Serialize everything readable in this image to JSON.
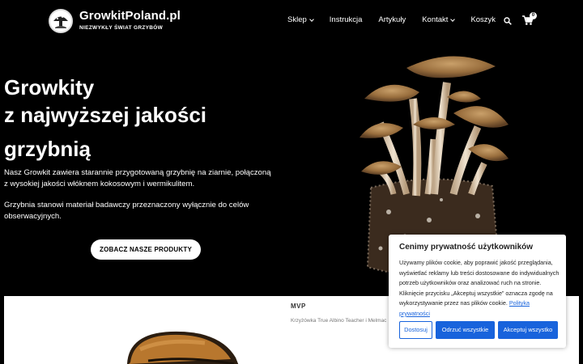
{
  "brand": {
    "name": "GrowkitPoland.pl",
    "tagline": "NIEZWYKŁY ŚWIAT GRZYBÓW"
  },
  "nav": {
    "items": [
      {
        "label": "Sklep",
        "dropdown": true
      },
      {
        "label": "Instrukcja",
        "dropdown": false
      },
      {
        "label": "Artykuły",
        "dropdown": false
      },
      {
        "label": "Kontakt",
        "dropdown": true
      },
      {
        "label": "Koszyk",
        "dropdown": false
      }
    ],
    "search_icon": "search-icon",
    "cart_icon": "cart-icon",
    "cart_count": "0"
  },
  "hero": {
    "title_line1": "Growkity",
    "title_line2": "z najwyższej jakości",
    "title_line3": "grzybnią",
    "paragraph1": "Nasz Growkit zawiera starannie przygotowaną grzybnię na ziarnie, połączoną z wysokiej jakości włóknem kokosowym i wermikulitem.",
    "paragraph2": "Grzybnia stanowi materiał badawczy przeznaczony wyłącznie do celów obserwacyjnych.",
    "cta_label": "ZOBACZ NASZE PRODUKTY"
  },
  "product": {
    "badge": "MVP",
    "description": "Krzyżówka True Albino Teacher i Melmac"
  },
  "cookie": {
    "title": "Cenimy prywatność użytkowników",
    "text": "Używamy plików cookie, aby poprawić jakość przeglądania, wyświetlać reklamy lub treści dostosowane do indywidualnych potrzeb użytkowników oraz analizować ruch na stronie. Kliknięcie przycisku „Akceptuj wszystkie” oznacza zgodę na wykorzystywanie przez nas plików cookie.",
    "link_label": "Polityka prywatności",
    "settings_label": "Dostosuj",
    "reject_label": "Odrzuć wszystkie",
    "accept_label": "Akceptuj wszystko"
  },
  "colors": {
    "background": "#000000",
    "accent": "#1863dc",
    "text": "#ffffff"
  }
}
